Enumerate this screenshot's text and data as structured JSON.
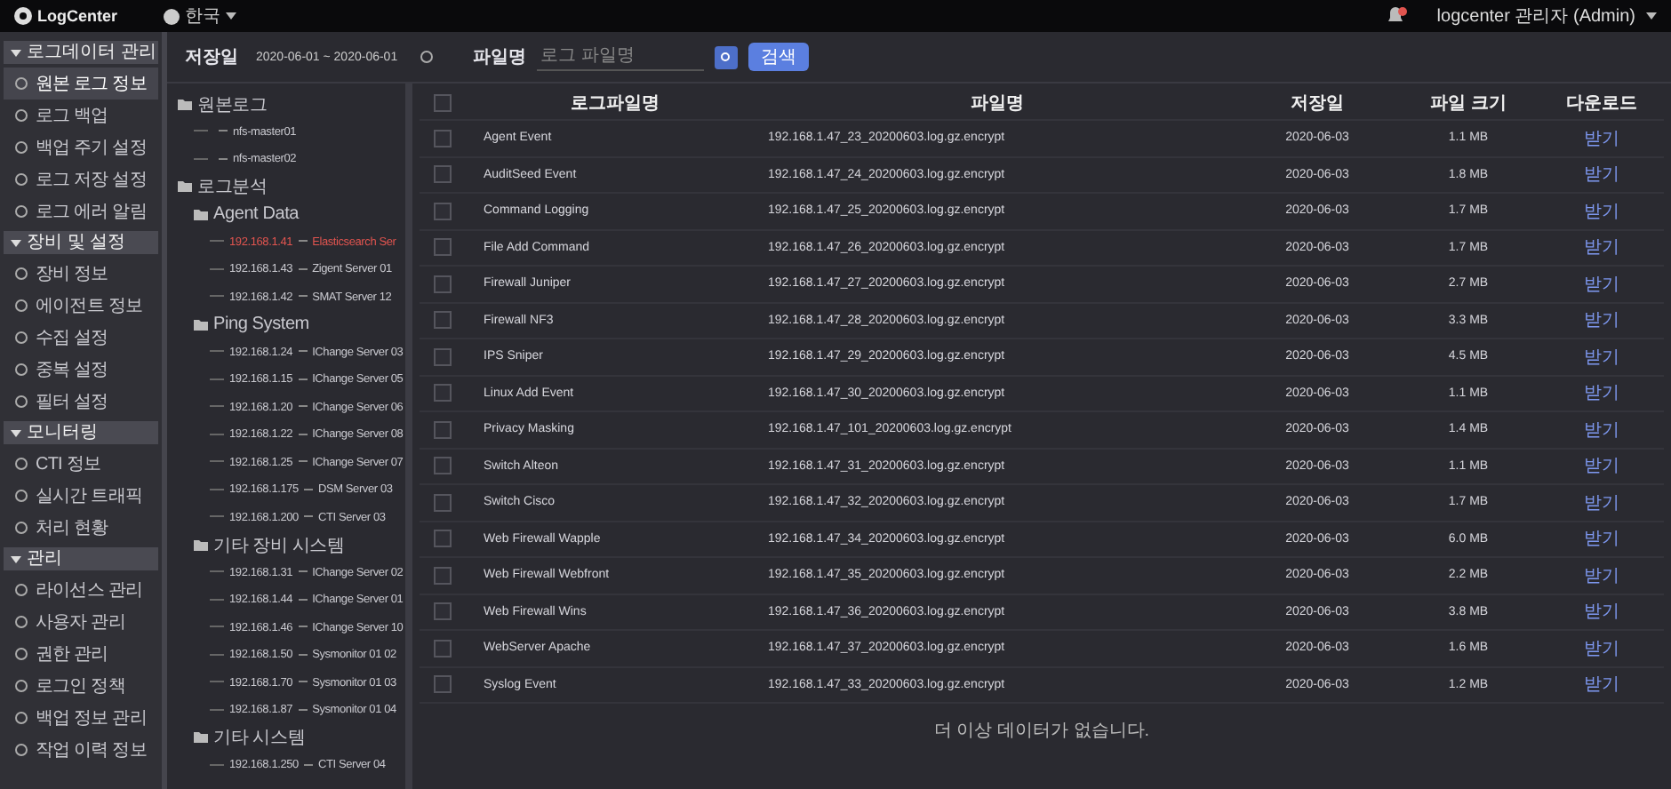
{
  "header": {
    "logo": "LogCenter",
    "language": "한국",
    "user": "logcenter 관리자 (Admin)",
    "notification": true
  },
  "sidebar": {
    "groups": [
      {
        "label": "로그데이터 관리",
        "expanded": true,
        "items": [
          {
            "label": "원본 로그 정보",
            "selected": true
          },
          {
            "label": "로그 백업",
            "selected": false
          },
          {
            "label": "백업 주기 설정",
            "selected": false
          },
          {
            "label": "로그 저장 설정",
            "selected": false
          },
          {
            "label": "로그 에러 알림",
            "selected": false
          }
        ]
      },
      {
        "label": "장비 및 설정",
        "expanded": true,
        "items": [
          {
            "label": "장비 정보",
            "selected": false
          },
          {
            "label": "에이전트 정보",
            "selected": false
          },
          {
            "label": "수집 설정",
            "selected": false
          },
          {
            "label": "중복 설정",
            "selected": false
          },
          {
            "label": "필터 설정",
            "selected": false
          }
        ]
      },
      {
        "label": "모니터링",
        "expanded": true,
        "items": [
          {
            "label": "CTI 정보",
            "selected": false
          },
          {
            "label": "실시간 트래픽",
            "selected": false
          },
          {
            "label": "처리 현황",
            "selected": false
          }
        ]
      },
      {
        "label": "관리",
        "expanded": true,
        "items": [
          {
            "label": "라이선스 관리",
            "selected": false
          },
          {
            "label": "사용자 관리",
            "selected": false
          },
          {
            "label": "권한 관리",
            "selected": false
          },
          {
            "label": "로그인 정책",
            "selected": false
          },
          {
            "label": "백업 정보 관리",
            "selected": false
          },
          {
            "label": "작업 이력 정보",
            "selected": false
          }
        ]
      }
    ]
  },
  "filters": {
    "date_label": "저장일",
    "date_range": "2020-06-01 ~ 2020-06-01",
    "file_label": "파일명",
    "file_placeholder": "로그 파일명",
    "search_button": "검색"
  },
  "tree": [
    {
      "label": "원본로그",
      "selected": false,
      "children": [
        {
          "label": "nfs-master01",
          "selected": false
        },
        {
          "label": "nfs-master02",
          "selected": false
        }
      ]
    },
    {
      "label": "로그분석",
      "selected": false,
      "children": [
        {
          "label": "Agent Data",
          "selected": false,
          "children": [
            {
              "ip": "192.168.1.41",
              "label": "Elasticsearch Ser",
              "selected": true
            },
            {
              "ip": "192.168.1.43",
              "label": "Zigent Server 01",
              "selected": false
            },
            {
              "ip": "192.168.1.42",
              "label": "SMAT Server 12",
              "selected": false
            }
          ]
        },
        {
          "label": "Ping System",
          "selected": false,
          "children": [
            {
              "ip": "192.168.1.24",
              "label": "IChange Server 03",
              "selected": false
            },
            {
              "ip": "192.168.1.15",
              "label": "IChange Server 05",
              "selected": false
            },
            {
              "ip": "192.168.1.20",
              "label": "IChange Server 06",
              "selected": false
            },
            {
              "ip": "192.168.1.22",
              "label": "IChange Server 08",
              "selected": false
            },
            {
              "ip": "192.168.1.25",
              "label": "IChange Server 07",
              "selected": false
            },
            {
              "ip": "192.168.1.175",
              "label": "DSM Server 03",
              "selected": false
            },
            {
              "ip": "192.168.1.200",
              "label": "CTI Server 03",
              "selected": false
            }
          ]
        },
        {
          "label": "기타 장비 시스템",
          "selected": false,
          "children": [
            {
              "ip": "192.168.1.31",
              "label": "IChange Server 02",
              "selected": false
            },
            {
              "ip": "192.168.1.44",
              "label": "IChange Server 01",
              "selected": false
            },
            {
              "ip": "192.168.1.46",
              "label": "IChange Server 10",
              "selected": false
            },
            {
              "ip": "192.168.1.50",
              "label": "Sysmonitor 01 02",
              "selected": false
            },
            {
              "ip": "192.168.1.70",
              "label": "Sysmonitor 01 03",
              "selected": false
            },
            {
              "ip": "192.168.1.87",
              "label": "Sysmonitor 01 04",
              "selected": false
            }
          ]
        },
        {
          "label": "기타 시스템",
          "selected": false,
          "children": [
            {
              "ip": "192.168.1.250",
              "label": "CTI Server 04",
              "selected": false
            }
          ]
        }
      ]
    }
  ],
  "table": {
    "all_checked": false,
    "columns": [
      "로그파일명",
      "파일명",
      "저장일",
      "파일 크기",
      "다운로드"
    ],
    "rows": [
      {
        "log": "Agent Event",
        "file": "192.168.1.47_23_20200603.log.gz.encrypt",
        "date": "2020-06-03",
        "size": "1.1 MB",
        "download": "받기",
        "checked": false
      },
      {
        "log": "AuditSeed Event",
        "file": "192.168.1.47_24_20200603.log.gz.encrypt",
        "date": "2020-06-03",
        "size": "1.8 MB",
        "download": "받기",
        "checked": false
      },
      {
        "log": "Command Logging",
        "file": "192.168.1.47_25_20200603.log.gz.encrypt",
        "date": "2020-06-03",
        "size": "1.7 MB",
        "download": "받기",
        "checked": false
      },
      {
        "log": "File Add Command",
        "file": "192.168.1.47_26_20200603.log.gz.encrypt",
        "date": "2020-06-03",
        "size": "1.7 MB",
        "download": "받기",
        "checked": false
      },
      {
        "log": "Firewall Juniper",
        "file": "192.168.1.47_27_20200603.log.gz.encrypt",
        "date": "2020-06-03",
        "size": "2.7 MB",
        "download": "받기",
        "checked": false
      },
      {
        "log": "Firewall NF3",
        "file": "192.168.1.47_28_20200603.log.gz.encrypt",
        "date": "2020-06-03",
        "size": "3.3 MB",
        "download": "받기",
        "checked": false
      },
      {
        "log": "IPS Sniper",
        "file": "192.168.1.47_29_20200603.log.gz.encrypt",
        "date": "2020-06-03",
        "size": "4.5 MB",
        "download": "받기",
        "checked": false
      },
      {
        "log": "Linux Add Event",
        "file": "192.168.1.47_30_20200603.log.gz.encrypt",
        "date": "2020-06-03",
        "size": "1.1 MB",
        "download": "받기",
        "checked": false
      },
      {
        "log": "Privacy Masking",
        "file": "192.168.1.47_101_20200603.log.gz.encrypt",
        "date": "2020-06-03",
        "size": "1.4 MB",
        "download": "받기",
        "checked": false
      },
      {
        "log": "Switch Alteon",
        "file": "192.168.1.47_31_20200603.log.gz.encrypt",
        "date": "2020-06-03",
        "size": "1.1 MB",
        "download": "받기",
        "checked": false
      },
      {
        "log": "Switch Cisco",
        "file": "192.168.1.47_32_20200603.log.gz.encrypt",
        "date": "2020-06-03",
        "size": "1.7 MB",
        "download": "받기",
        "checked": false
      },
      {
        "log": "Web Firewall Wapple",
        "file": "192.168.1.47_34_20200603.log.gz.encrypt",
        "date": "2020-06-03",
        "size": "6.0 MB",
        "download": "받기",
        "checked": false
      },
      {
        "log": "Web Firewall Webfront",
        "file": "192.168.1.47_35_20200603.log.gz.encrypt",
        "date": "2020-06-03",
        "size": "2.2 MB",
        "download": "받기",
        "checked": false
      },
      {
        "log": "Web Firewall Wins",
        "file": "192.168.1.47_36_20200603.log.gz.encrypt",
        "date": "2020-06-03",
        "size": "3.8 MB",
        "download": "받기",
        "checked": false
      },
      {
        "log": "WebServer Apache",
        "file": "192.168.1.47_37_20200603.log.gz.encrypt",
        "date": "2020-06-03",
        "size": "1.6 MB",
        "download": "받기",
        "checked": false
      },
      {
        "log": "Syslog Event",
        "file": "192.168.1.47_33_20200603.log.gz.encrypt",
        "date": "2020-06-03",
        "size": "1.2 MB",
        "download": "받기",
        "checked": false
      }
    ],
    "footer": "더 이상 데이터가 없습니다."
  }
}
